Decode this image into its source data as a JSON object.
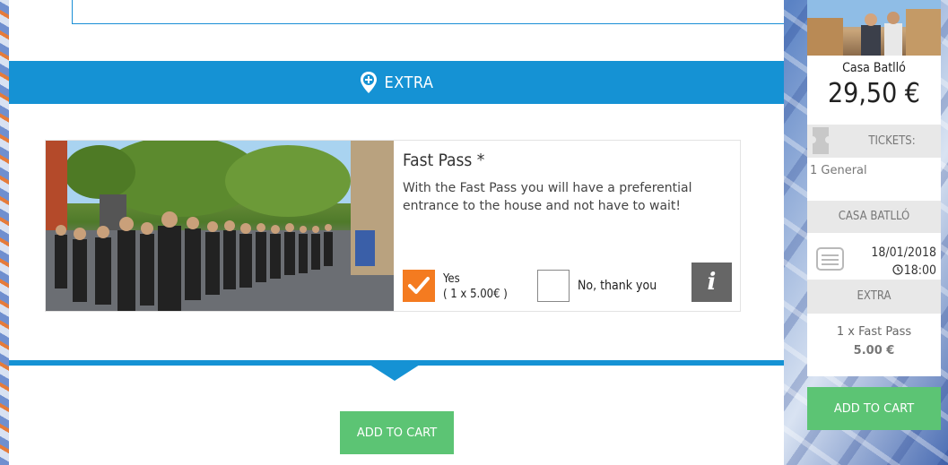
{
  "extra_section": {
    "title": "EXTRA"
  },
  "fast_pass": {
    "title": "Fast Pass *",
    "description": "With the Fast Pass you will have a preferential entrance to the house and not have to wait!",
    "yes_label": "Yes",
    "yes_price": "( 1 x 5.00€ )",
    "yes_checked": true,
    "no_label": "No, thank you",
    "no_checked": false,
    "info_label": "i"
  },
  "main_cart_button": "ADD TO CART",
  "sidebar": {
    "name": "Casa Batlló",
    "price": "29,50 €",
    "tickets_label": "TICKETS:",
    "tickets_value": "1 General",
    "venue_label": "CASA BATLLÓ",
    "date": "18/01/2018",
    "time": "18:00",
    "extra_label": "EXTRA",
    "extra_item": "1 x Fast Pass",
    "extra_price": "5.00 €",
    "cart_button": "ADD TO CART"
  },
  "colors": {
    "primary_blue": "#1592d4",
    "check_orange": "#f47b20",
    "cart_green": "#5cc474",
    "info_gray": "#666666"
  },
  "icons": [
    "location-plus-icon",
    "check-icon",
    "info-icon",
    "ticket-icon",
    "calendar-icon",
    "clock-icon"
  ]
}
